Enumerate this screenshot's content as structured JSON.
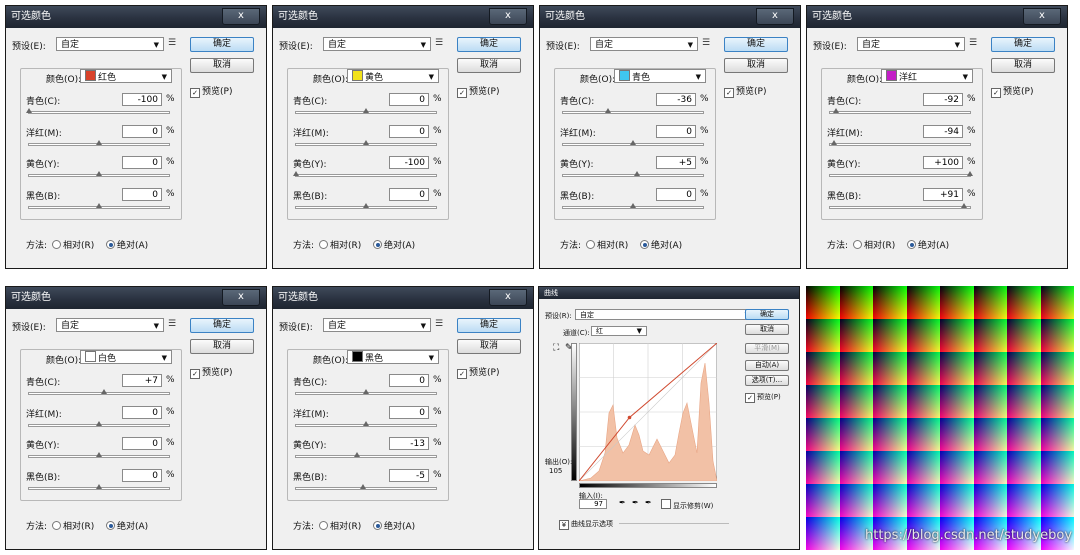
{
  "selective_color": {
    "title": "可选颜色",
    "close": "x",
    "preset_label": "预设(E):",
    "preset_value": "自定",
    "ok": "确定",
    "cancel": "取消",
    "preview": "预览(P)",
    "color_label": "颜色(O):",
    "method_label": "方法:",
    "relative": "相对(R)",
    "absolute": "绝对(A)",
    "pct": "%",
    "sliders": [
      "青色(C):",
      "洋红(M):",
      "黄色(Y):",
      "黑色(B):"
    ]
  },
  "panels": [
    {
      "color_name": "红色",
      "swatch": "#d9422a",
      "values": [
        "-100",
        "0",
        "0",
        "0"
      ],
      "levels": [
        -100,
        0,
        0,
        0
      ]
    },
    {
      "color_name": "黄色",
      "swatch": "#f2e21a",
      "values": [
        "0",
        "0",
        "-100",
        "0"
      ],
      "levels": [
        0,
        0,
        -100,
        0
      ]
    },
    {
      "color_name": "青色",
      "swatch": "#3fc7ef",
      "values": [
        "-36",
        "0",
        "+5",
        "0"
      ],
      "levels": [
        -36,
        0,
        5,
        0
      ]
    },
    {
      "color_name": "洋红",
      "swatch": "#c31fc7",
      "values": [
        "-92",
        "-94",
        "+100",
        "+91"
      ],
      "levels": [
        -92,
        -94,
        100,
        91
      ]
    },
    {
      "color_name": "白色",
      "swatch": "#ffffff",
      "values": [
        "+7",
        "0",
        "0",
        "0"
      ],
      "levels": [
        7,
        0,
        0,
        0
      ]
    },
    {
      "color_name": "黑色",
      "swatch": "#000000",
      "values": [
        "0",
        "0",
        "-13",
        "-5"
      ],
      "levels": [
        0,
        0,
        -13,
        -5
      ]
    }
  ],
  "curves": {
    "title": "曲线",
    "preset_label": "预设(R):",
    "preset_value": "自定",
    "channel_label": "通道(C):",
    "channel_value": "红",
    "ok": "确定",
    "cancel": "取消",
    "smooth": "平滑(M)",
    "auto": "自动(A)",
    "options": "选项(T)...",
    "preview": "预览(P)",
    "output_label": "输出(O):",
    "output_value": "105",
    "input_label": "输入(I):",
    "input_value": "97",
    "show_clipping": "显示修剪(W)",
    "display_options": "曲线显示选项"
  },
  "watermark": "https://blog.csdn.net/studyeboy"
}
